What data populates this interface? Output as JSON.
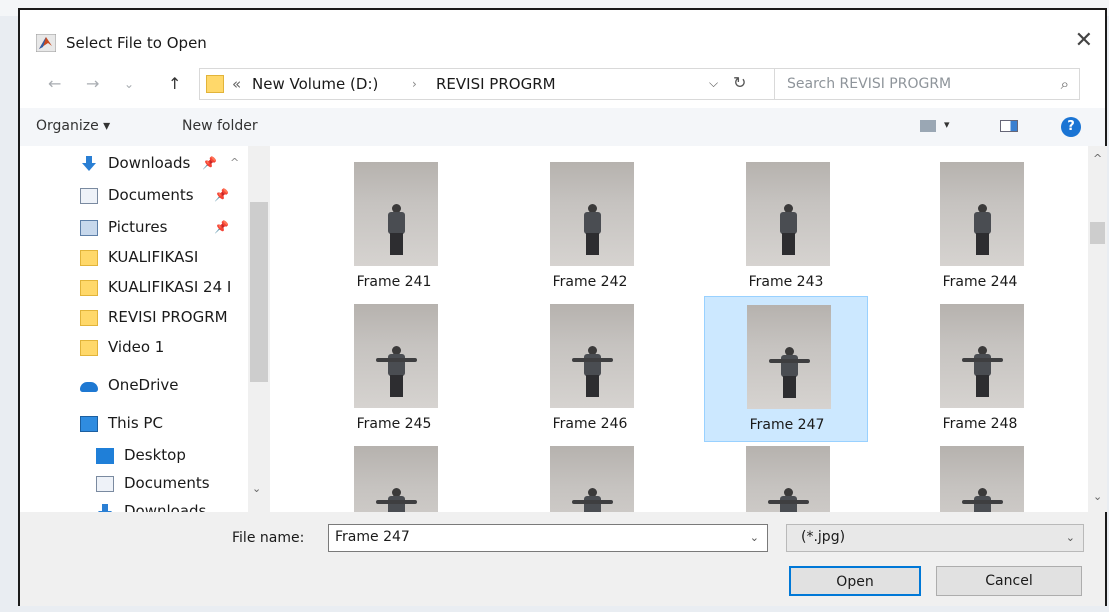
{
  "window": {
    "title": "Select File to Open",
    "close": "✕"
  },
  "nav": {
    "back": "←",
    "forward": "→",
    "recent": "⌄",
    "up": "↑"
  },
  "address": {
    "prefix": "«",
    "crumbs": [
      "New Volume (D:)",
      "REVISI PROGRM"
    ],
    "separator": "›",
    "dropdown": "⌵",
    "refresh": "↻"
  },
  "search": {
    "placeholder": "Search REVISI PROGRM",
    "icon": "⌕"
  },
  "toolbar": {
    "organize": "Organize ▾",
    "new_folder": "New folder",
    "view_dropdown": "▾",
    "help": "?"
  },
  "sidebar": {
    "items": [
      {
        "label": "Downloads",
        "icon": "download-icon",
        "pinned": true
      },
      {
        "label": "Documents",
        "icon": "document-icon",
        "pinned": true
      },
      {
        "label": "Pictures",
        "icon": "pictures-icon",
        "pinned": true
      },
      {
        "label": "KUALIFIKASI",
        "icon": "folder-icon"
      },
      {
        "label": "KUALIFIKASI 24 I",
        "icon": "folder-icon"
      },
      {
        "label": "REVISI PROGRM",
        "icon": "folder-icon"
      },
      {
        "label": "Video 1",
        "icon": "folder-icon"
      },
      {
        "label": "OneDrive",
        "icon": "onedrive-icon"
      },
      {
        "label": "This PC",
        "icon": "pc-icon"
      },
      {
        "label": "Desktop",
        "icon": "desktop-icon"
      },
      {
        "label": "Documents",
        "icon": "document-icon"
      },
      {
        "label": "Downloads",
        "icon": "download-icon"
      }
    ],
    "pin_glyph": "📌"
  },
  "files": {
    "items": [
      {
        "label": "Frame 241"
      },
      {
        "label": "Frame 242"
      },
      {
        "label": "Frame 243"
      },
      {
        "label": "Frame 244"
      },
      {
        "label": "Frame 245"
      },
      {
        "label": "Frame 246"
      },
      {
        "label": "Frame 247",
        "selected": true
      },
      {
        "label": "Frame 248"
      },
      {
        "label": ""
      },
      {
        "label": ""
      },
      {
        "label": ""
      },
      {
        "label": ""
      }
    ]
  },
  "footer": {
    "file_name_label": "File name:",
    "file_name_value": "Frame 247",
    "filter_value": "(*.jpg)",
    "open": "Open",
    "cancel": "Cancel"
  },
  "colors": {
    "selection": "#cce8ff",
    "accent": "#0078d7",
    "folder": "#ffd86a"
  }
}
